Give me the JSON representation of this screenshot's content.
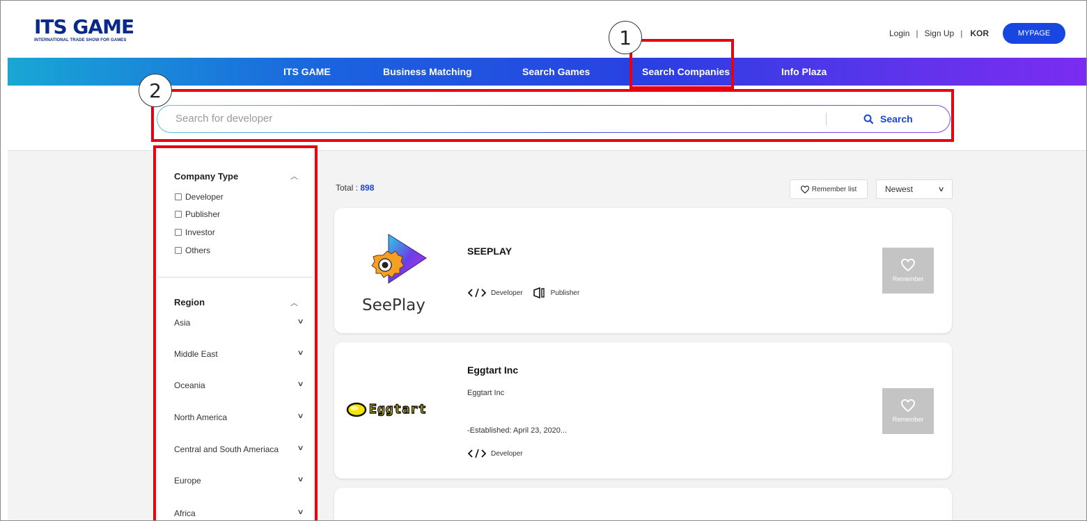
{
  "logo": {
    "main": "ITS GAME",
    "sub": "INTERNATIONAL TRADE SHOW FOR GAMES"
  },
  "top_links": {
    "login": "Login",
    "signup": "Sign Up",
    "lang": "KOR",
    "mypage": "MYPAGE",
    "separator": "|"
  },
  "nav": {
    "items": [
      "ITS GAME",
      "Business Matching",
      "Search Games",
      "Search Companies",
      "Info Plaza"
    ],
    "active": "Search Companies"
  },
  "search": {
    "placeholder": "Search for developer",
    "value": "",
    "button": "Search"
  },
  "filters": {
    "company_type": {
      "title": "Company Type",
      "options": [
        "Developer",
        "Publisher",
        "Investor",
        "Others"
      ]
    },
    "region": {
      "title": "Region",
      "options": [
        "Asia",
        "Middle East",
        "Oceania",
        "North America",
        "Central and South Ameriaca",
        "Europe",
        "Africa"
      ]
    }
  },
  "results": {
    "total_label": "Total : ",
    "total_value": "898",
    "remember_list": "Remember list",
    "sort": "Newest",
    "cards": [
      {
        "name": "SEEPLAY",
        "logo_text": "SeePlay",
        "desc1": "",
        "desc2": "",
        "tags": [
          "Developer",
          "Publisher"
        ],
        "remember": "Remember"
      },
      {
        "name": "Eggtart Inc",
        "logo_text": "Eggtart",
        "desc1": "Eggtart Inc",
        "desc2": "-Established: April 23, 2020...",
        "tags": [
          "Developer"
        ],
        "remember": "Remember"
      }
    ]
  },
  "annotations": [
    "1",
    "2"
  ],
  "colors": {
    "accent": "#1a44d6",
    "annotation": "#e60012",
    "nav_start": "#19a7d4",
    "nav_end": "#7b2cf0"
  }
}
